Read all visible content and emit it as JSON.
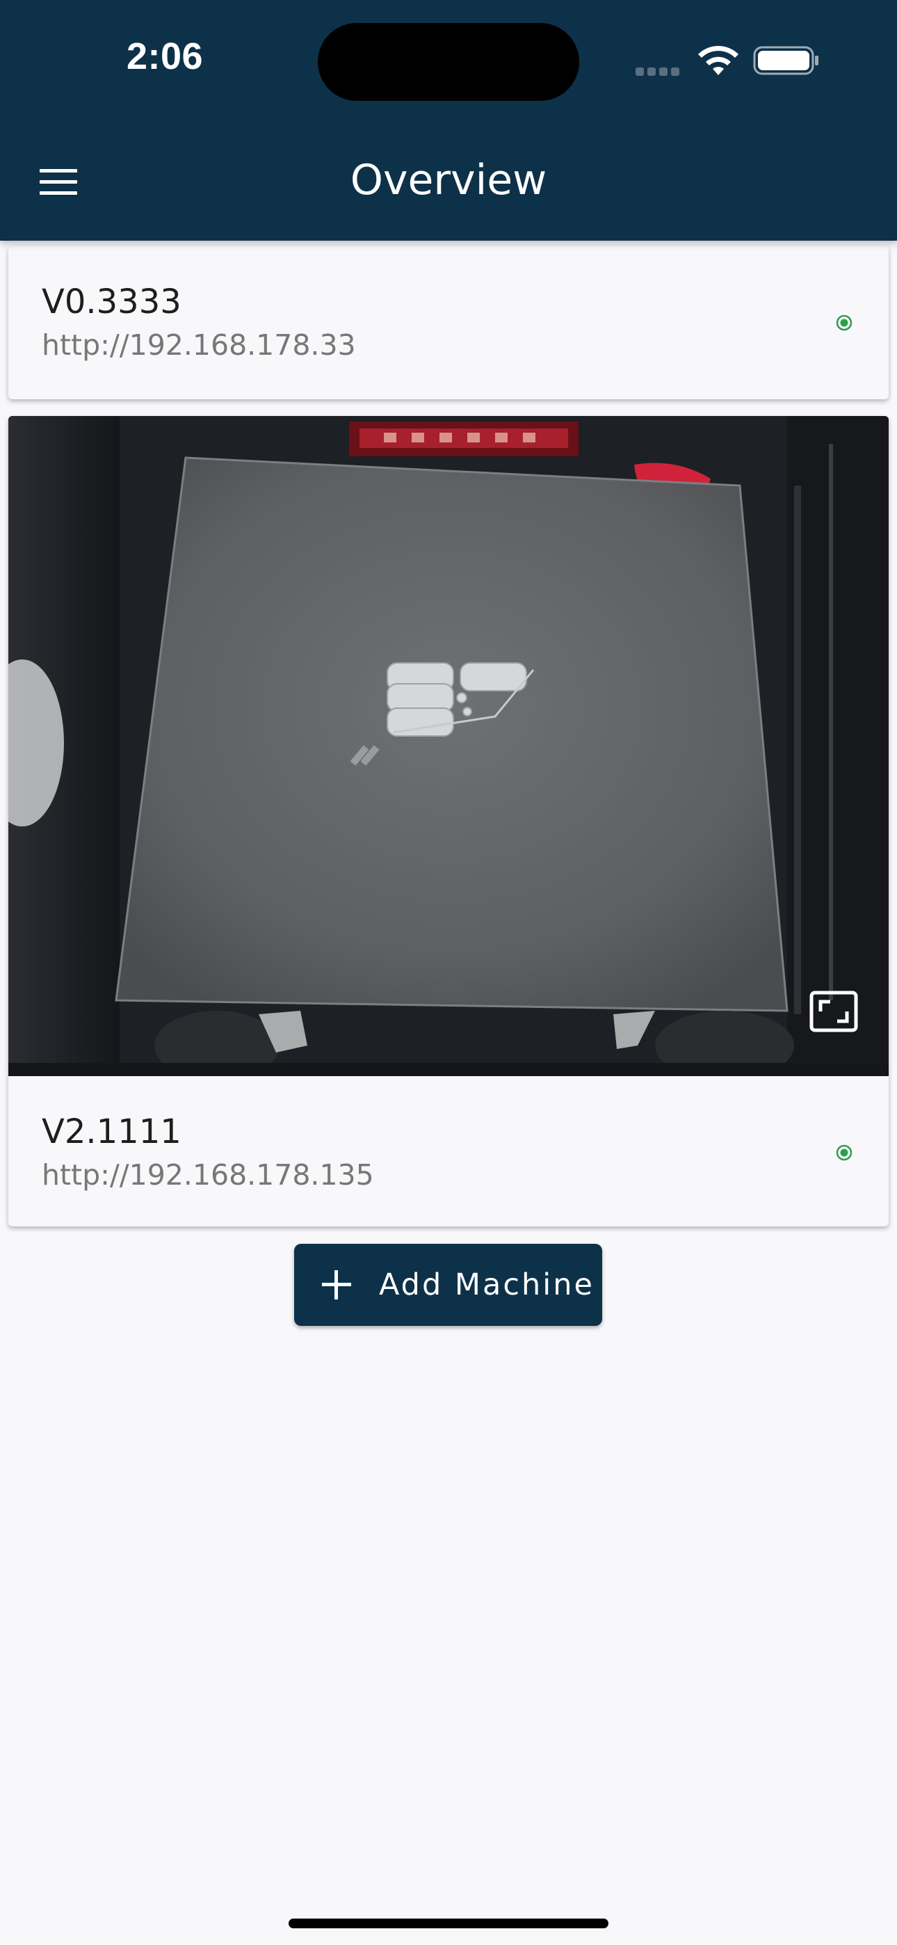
{
  "status_bar": {
    "time": "2:06"
  },
  "header": {
    "title": "Overview",
    "menu_icon": "hamburger-menu-icon"
  },
  "machines": [
    {
      "name": "V0.3333",
      "url": "http://192.168.178.33",
      "status": "online",
      "status_color": "#2e9e4e",
      "has_webcam": false
    },
    {
      "name": "V2.1111",
      "url": "http://192.168.178.135",
      "status": "online",
      "status_color": "#2e9e4e",
      "has_webcam": true,
      "webcam_controls": {
        "fullscreen_icon": "fullscreen-icon"
      }
    }
  ],
  "add_machine": {
    "label": "Add Machine",
    "icon": "plus-icon"
  },
  "theme": {
    "primary": "#0d3148",
    "background": "#f8f8fb",
    "on_primary": "#ffffff"
  }
}
